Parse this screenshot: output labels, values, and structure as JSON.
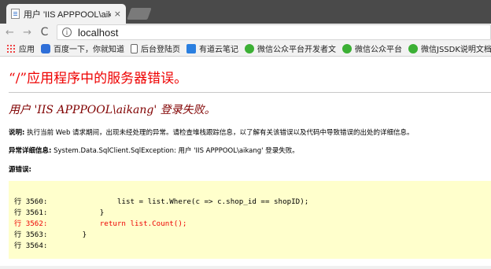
{
  "browser": {
    "tab_title": "用户 'IIS APPPOOL\\aikang",
    "tab_close": "×",
    "url": "localhost",
    "back_icon": "←",
    "forward_icon": "→",
    "reload_icon": "C",
    "info_icon": "i",
    "bookmarks": [
      {
        "label": "应用",
        "icon": "apps-icon"
      },
      {
        "label": "百度一下，你就知道",
        "icon": "paw-icon"
      },
      {
        "label": "后台登陆页",
        "icon": "doc-icon"
      },
      {
        "label": "有道云笔记",
        "icon": "note-icon"
      },
      {
        "label": "微信公众平台开发者文",
        "icon": "wx-icon"
      },
      {
        "label": "微信公众平台",
        "icon": "wx-icon"
      },
      {
        "label": "微信JSSDK说明文档",
        "icon": "wx-icon"
      }
    ]
  },
  "page": {
    "title": "“/”应用程序中的服务器错误。",
    "subtitle": "用户 'IIS APPPOOL\\aikang' 登录失败。",
    "description_label": "说明:",
    "description_text": " 执行当前 Web 请求期间，出现未经处理的异常。请检查堆栈跟踪信息，以了解有关该错误以及代码中导致错误的出处的详细信息。",
    "exception_label": "异常详细信息:",
    "exception_text": " System.Data.SqlClient.SqlException: 用户 'IIS APPPOOL\\aikang' 登录失败。",
    "source_label": "源错误:",
    "code_lines": [
      {
        "text": "行 3560:                list = list.Where(c => c.shop_id == shopID);",
        "highlight": false
      },
      {
        "text": "行 3561:            }",
        "highlight": false
      },
      {
        "text": "行 3562:            return list.Count();",
        "highlight": true
      },
      {
        "text": "行 3563:        }",
        "highlight": false
      },
      {
        "text": "行 3564:",
        "highlight": false
      }
    ]
  },
  "colors": {
    "error_red": "#ee0000",
    "subtitle_maroon": "#800000",
    "code_bg": "#ffffcc"
  }
}
